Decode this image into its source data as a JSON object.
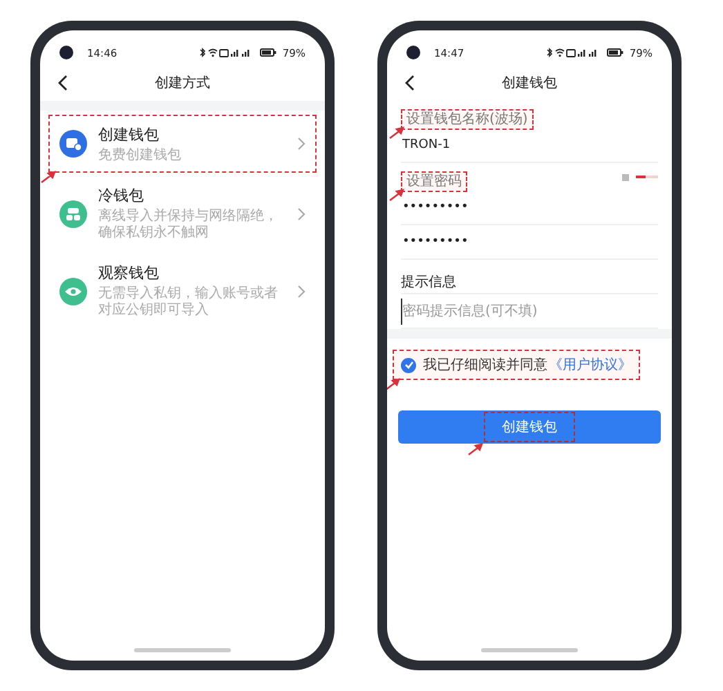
{
  "phones": [
    {
      "kind": "methods",
      "status": {
        "time": "14:46",
        "battery": "79%"
      },
      "title": "创建方式",
      "options": [
        {
          "kind": "create",
          "title": "创建钱包",
          "desc": "免费创建钱包",
          "highlighted": true
        },
        {
          "kind": "cold",
          "title": "冷钱包",
          "desc": "离线导入并保持与网络隔绝，确保私钥永不触网",
          "highlighted": false
        },
        {
          "kind": "watch",
          "title": "观察钱包",
          "desc": "无需导入私钥，输入账号或者对应公钥即可导入",
          "highlighted": false
        }
      ]
    },
    {
      "kind": "form",
      "status": {
        "time": "14:47",
        "battery": "79%"
      },
      "title": "创建钱包",
      "fields": [
        {
          "kind": "label",
          "text": "设置钱包名称(波场)",
          "highlighted": true
        },
        {
          "kind": "value",
          "text": "TRON-1"
        },
        {
          "kind": "label",
          "text": "设置密码",
          "highlighted": true,
          "level": 0.45
        },
        {
          "kind": "value",
          "text": "•••••••••"
        },
        {
          "kind": "value",
          "text": "•••••••••"
        },
        {
          "kind": "section",
          "text": "提示信息"
        },
        {
          "kind": "input",
          "placeholder": "密码提示信息(可不填)"
        }
      ],
      "agreement": {
        "checked": true,
        "text": "我已仔细阅读并同意",
        "link": "《用户协议》",
        "highlighted": true
      },
      "button": {
        "label": "创建钱包",
        "highlighted": true
      }
    }
  ]
}
